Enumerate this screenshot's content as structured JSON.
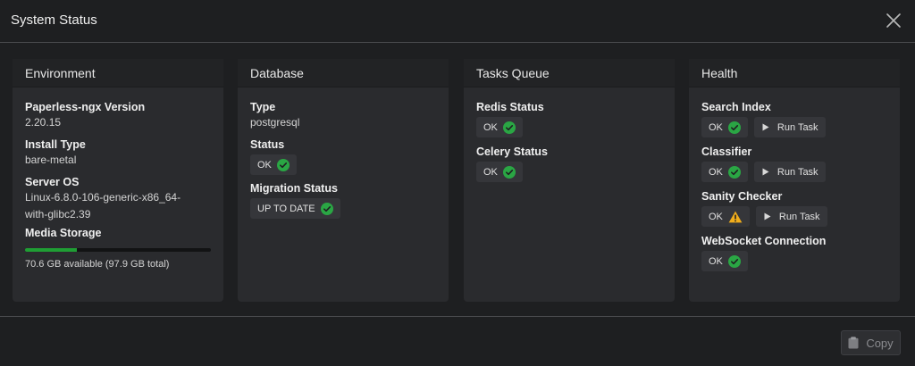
{
  "modal": {
    "title": "System Status",
    "copy_label": "Copy"
  },
  "colors": {
    "ok": "#2aa644",
    "warning": "#f0ad1c",
    "storage_fill": "#1f9e34"
  },
  "environment": {
    "header": "Environment",
    "version_label": "Paperless-ngx Version",
    "version_value": "2.20.15",
    "install_label": "Install Type",
    "install_value": "bare-metal",
    "os_label": "Server OS",
    "os_line1": "Linux-6.8.0-106-generic-x86_64-",
    "os_line2": "with-glibc2.39",
    "storage_label": "Media Storage",
    "storage_used_fraction": 0.28,
    "storage_text": "70.6 GB available (97.9 GB total)"
  },
  "database": {
    "header": "Database",
    "type_label": "Type",
    "type_value": "postgresql",
    "status_label": "Status",
    "status_value": "OK",
    "migration_label": "Migration Status",
    "migration_value": "UP TO DATE"
  },
  "tasks": {
    "header": "Tasks Queue",
    "redis_label": "Redis Status",
    "redis_value": "OK",
    "celery_label": "Celery Status",
    "celery_value": "OK"
  },
  "health": {
    "header": "Health",
    "run_task_label": "Run Task",
    "search_label": "Search Index",
    "search_value": "OK",
    "classifier_label": "Classifier",
    "classifier_value": "OK",
    "sanity_label": "Sanity Checker",
    "sanity_value": "OK",
    "websocket_label": "WebSocket Connection",
    "websocket_value": "OK"
  }
}
